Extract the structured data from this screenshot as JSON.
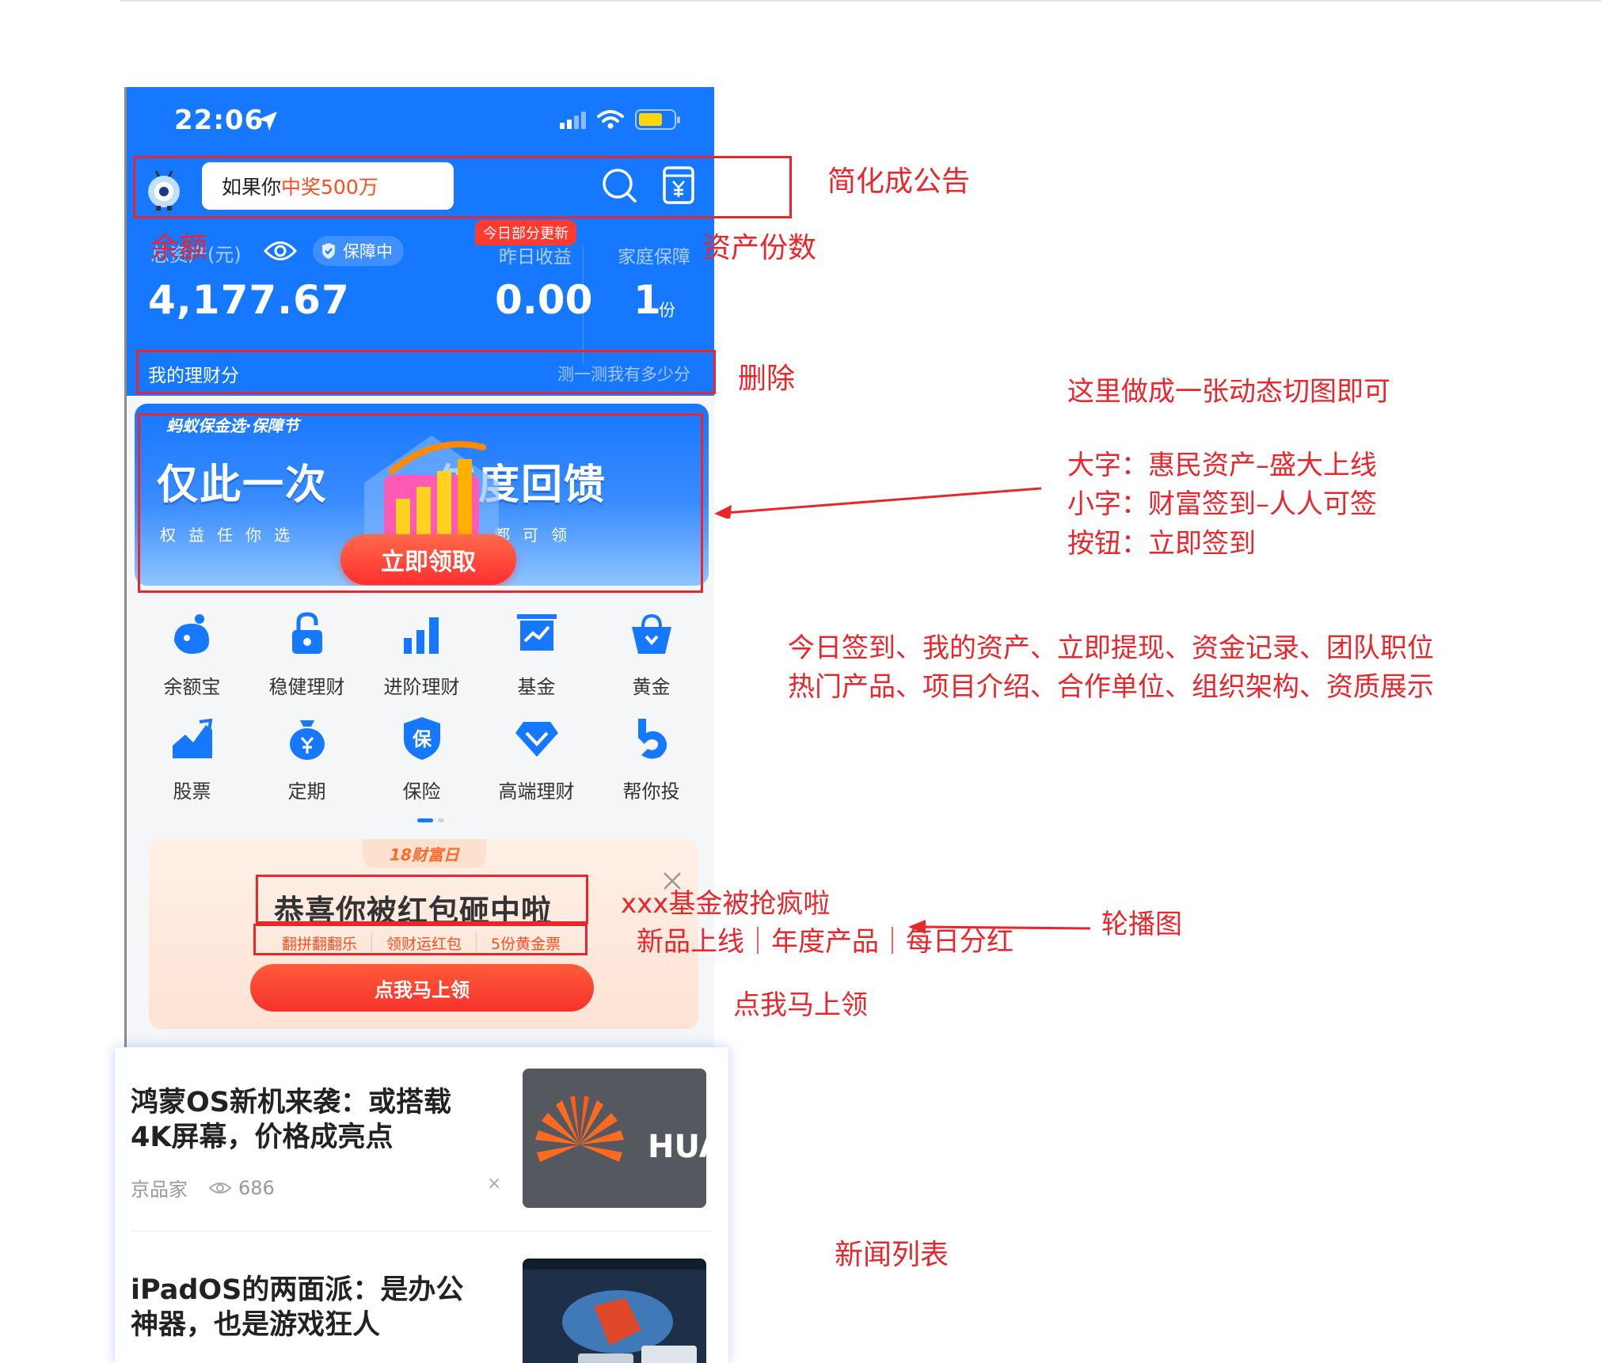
{
  "status_bar": {
    "time": "22:06"
  },
  "header": {
    "notice_prefix": "如果你",
    "notice_highlight": "中奖500万"
  },
  "account": {
    "balance_label": "总资产(元)",
    "guard_label": "保障中",
    "update_badge": "今日部分更新",
    "yesterday_label": "昨日收益",
    "family_label": "家庭保障",
    "balance_value": "4,177.67",
    "yesterday_value": "0.00",
    "family_value": "1",
    "family_unit": "份"
  },
  "score_bar": {
    "left": "我的理财分",
    "right": "测一测我有多少分"
  },
  "banner": {
    "brand": "蚂蚁保金选·保障节",
    "big_left": "仅此一次",
    "sub_left": "权益任你选",
    "big_right": "年度回馈",
    "sub_right": "人人都可领",
    "button": "立即领取"
  },
  "grid": [
    {
      "label": "余额宝",
      "icon": "yuebao-icon"
    },
    {
      "label": "稳健理财",
      "icon": "lock-icon"
    },
    {
      "label": "进阶理财",
      "icon": "bar-chart-icon"
    },
    {
      "label": "基金",
      "icon": "fund-icon"
    },
    {
      "label": "黄金",
      "icon": "gold-bag-icon"
    },
    {
      "label": "股票",
      "icon": "stock-icon"
    },
    {
      "label": "定期",
      "icon": "money-bag-icon"
    },
    {
      "label": "保险",
      "icon": "shield-icon"
    },
    {
      "label": "高端理财",
      "icon": "diamond-icon"
    },
    {
      "label": "帮你投",
      "icon": "helper-icon"
    }
  ],
  "promo": {
    "tag": "18财富日",
    "title": "恭喜你被红包砸中啦",
    "tags": [
      "翻拼翻翻乐",
      "领财运红包",
      "5份黄金票"
    ],
    "button": "点我马上领"
  },
  "news": [
    {
      "title": "鸿蒙OS新机来袭：或搭载4K屏幕，价格成亮点",
      "source": "京品家",
      "views": "686",
      "thumb_text": "HUAW"
    },
    {
      "title": "iPadOS的两面派：是办公神器，也是游戏狂人"
    }
  ],
  "annotations": {
    "header": "简化成公告",
    "balance_overlay": "余额",
    "asset_count": "资产份数",
    "delete": "删除",
    "banner_note": "这里做成一张动态切图即可",
    "banner_big": "大字：惠民资产–盛大上线",
    "banner_small": "小字：财富签到–人人可签",
    "banner_button": "按钮：立即签到",
    "grid_line1": "今日签到、我的资产、立即提现、资金记录、团队职位",
    "grid_line2": "热门产品、项目介绍、合作单位、组织架构、资质展示",
    "promo_title": "xxx基金被抢疯啦",
    "promo_tags": "新品上线｜年度产品｜每日分红",
    "carousel": "轮播图",
    "promo_button": "点我马上领",
    "news_list": "新闻列表"
  }
}
